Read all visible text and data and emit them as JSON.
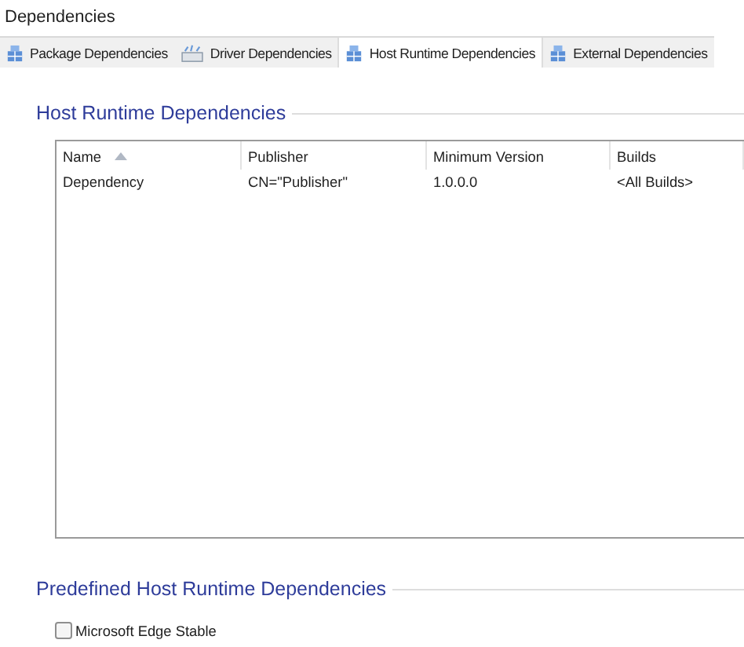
{
  "page_title": "Dependencies",
  "tabs": [
    {
      "label": "Package Dependencies",
      "kind": "box",
      "selected": false
    },
    {
      "label": "Driver Dependencies",
      "kind": "card",
      "selected": false
    },
    {
      "label": "Host Runtime Dependencies",
      "kind": "box",
      "selected": true
    },
    {
      "label": "External Dependencies",
      "kind": "box",
      "selected": false
    }
  ],
  "host_runtime": {
    "title": "Host Runtime Dependencies",
    "table": {
      "columns": [
        {
          "label": "Name",
          "sorted": true
        },
        {
          "label": "Publisher",
          "sorted": false
        },
        {
          "label": "Minimum Version",
          "sorted": false
        },
        {
          "label": "Builds",
          "sorted": false
        }
      ],
      "rows": [
        [
          "Dependency",
          "CN=\"Publisher\"",
          "1.0.0.0",
          "<All Builds>"
        ]
      ]
    }
  },
  "predefined": {
    "title": "Predefined Host Runtime Dependencies",
    "options": [
      {
        "label": "Microsoft Edge Stable",
        "checked": false
      }
    ]
  }
}
